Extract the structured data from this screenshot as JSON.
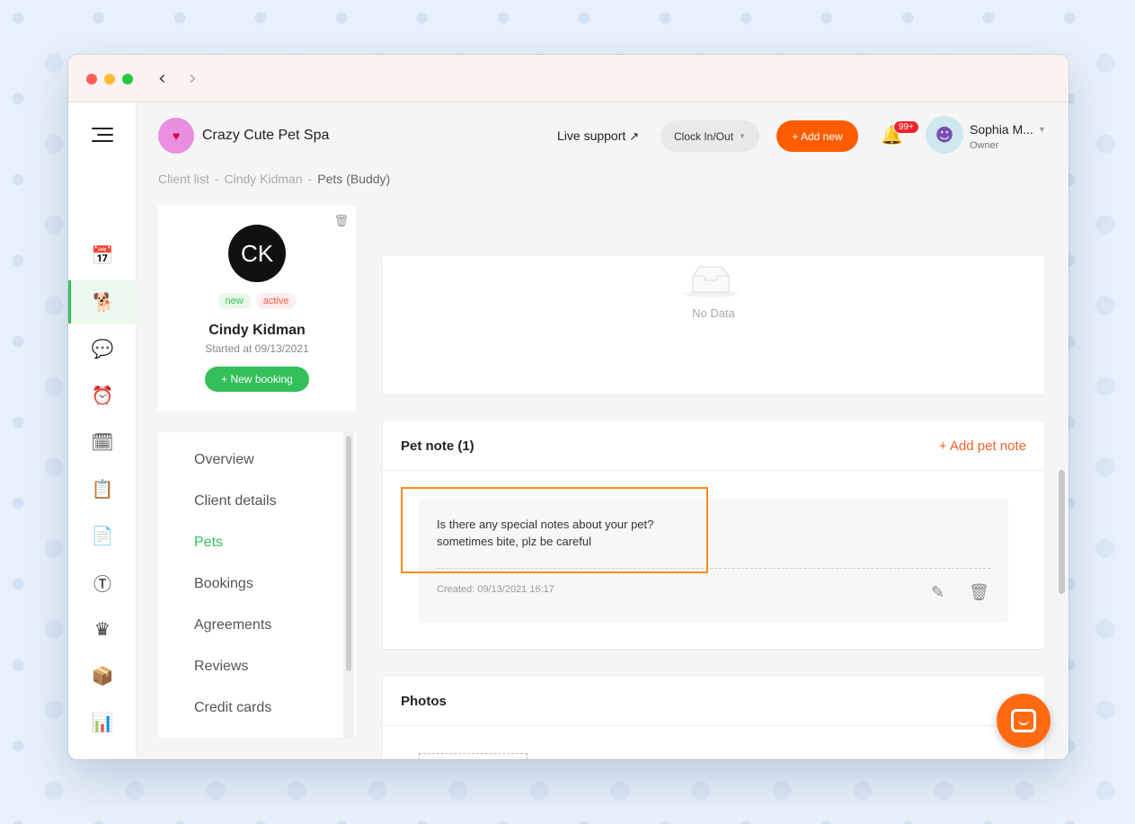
{
  "header": {
    "business_name": "Crazy Cute Pet Spa",
    "live_support": "Live support",
    "clock_label": "Clock In/Out",
    "add_new_label": "+ Add new",
    "notification_count": "99+",
    "user_name": "Sophia M...",
    "user_role": "Owner"
  },
  "breadcrumb": {
    "items": [
      "Client list",
      "Cindy Kidman"
    ],
    "current": "Pets (Buddy)"
  },
  "client": {
    "initials": "CK",
    "tags": [
      "new",
      "active"
    ],
    "name": "Cindy Kidman",
    "started": "Started at 09/13/2021",
    "new_booking_label": "+ New booking"
  },
  "side_menu": {
    "items": [
      "Overview",
      "Client details",
      "Pets",
      "Bookings",
      "Agreements",
      "Reviews",
      "Credit cards"
    ],
    "active": "Pets"
  },
  "nodata": {
    "text": "No Data"
  },
  "pet_note": {
    "title": "Pet note (1)",
    "add_label": "+ Add pet note",
    "question": "Is there any special notes about your pet?",
    "answer": "sometimes bite, plz be careful",
    "created": "Created: 09/13/2021 16:17"
  },
  "photos": {
    "title": "Photos"
  },
  "icons": {
    "sidebar": [
      "calendar-icon",
      "dog-icon",
      "chat-icon",
      "alarm-icon",
      "schedule-icon",
      "clipboard-icon",
      "document-icon",
      "dollar-icon",
      "crown-icon",
      "gift-calendar-icon",
      "bar-chart-icon",
      "settings-icon"
    ]
  },
  "colors": {
    "accent_green": "#33c05a",
    "accent_orange": "#ff5c00",
    "highlight": "#ff8c1a"
  }
}
